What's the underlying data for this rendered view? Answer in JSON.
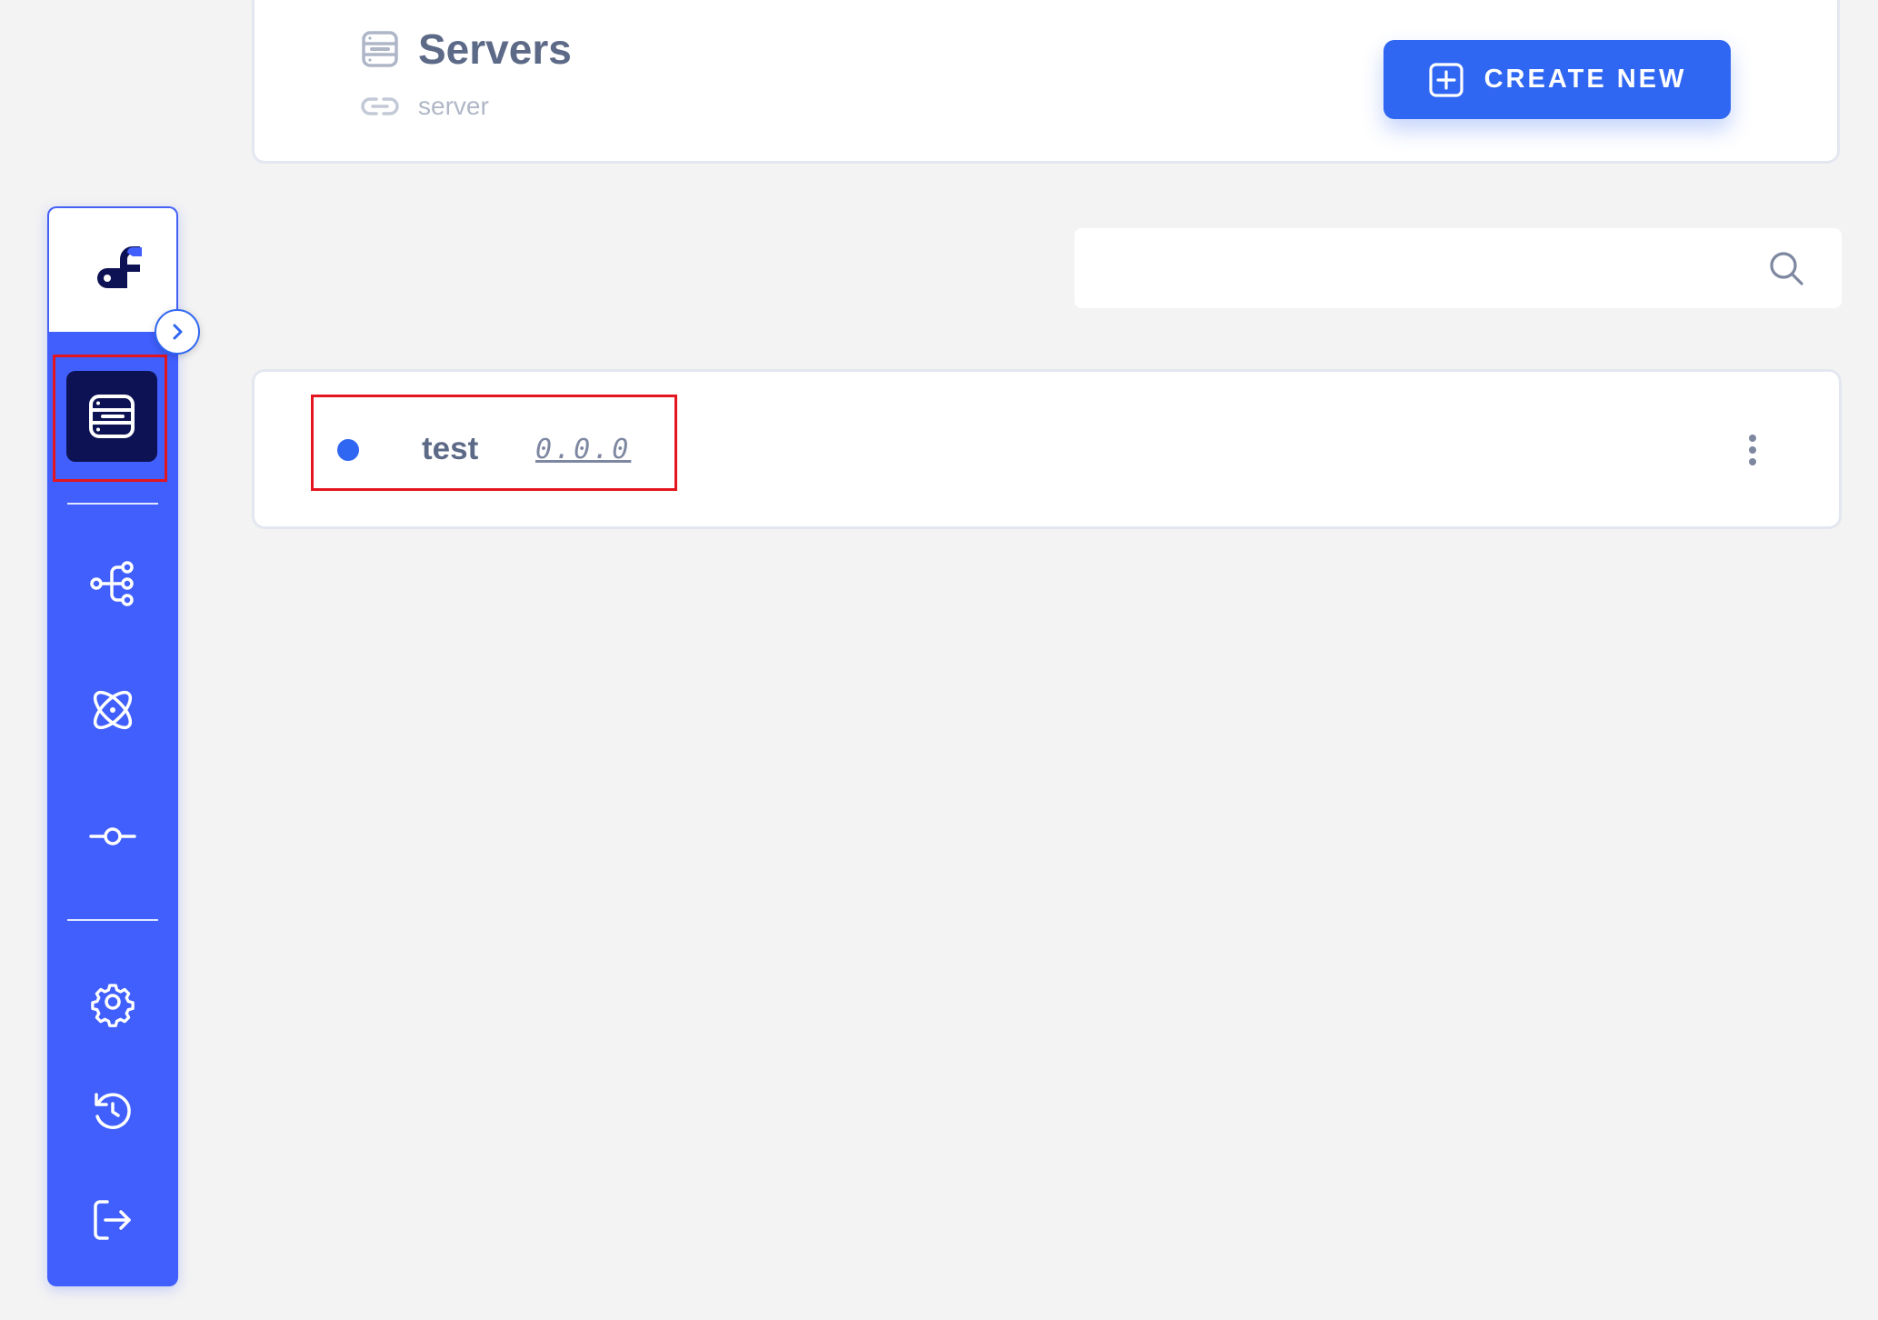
{
  "header": {
    "title": "Servers",
    "slug": "server",
    "create_button_label": "CREATE NEW"
  },
  "search": {
    "placeholder": "",
    "value": ""
  },
  "servers": [
    {
      "name": "test",
      "version": "0.0.0",
      "status": "active",
      "status_color": "#2f66f2"
    }
  ],
  "sidebar": {
    "items": [
      {
        "name": "servers",
        "icon": "server-icon",
        "active": true
      },
      {
        "name": "flows",
        "icon": "flow-tree-icon"
      },
      {
        "name": "components",
        "icon": "atom-icon"
      },
      {
        "name": "commits",
        "icon": "commit-icon"
      },
      {
        "name": "settings",
        "icon": "gear-icon"
      },
      {
        "name": "history",
        "icon": "history-icon"
      },
      {
        "name": "logout",
        "icon": "logout-icon"
      }
    ]
  },
  "colors": {
    "accent": "#2f66f2",
    "sidebar": "#405ffc",
    "sidebar_active": "#0d1254",
    "title_text": "#5d6a87",
    "highlight": "#e3161f"
  }
}
